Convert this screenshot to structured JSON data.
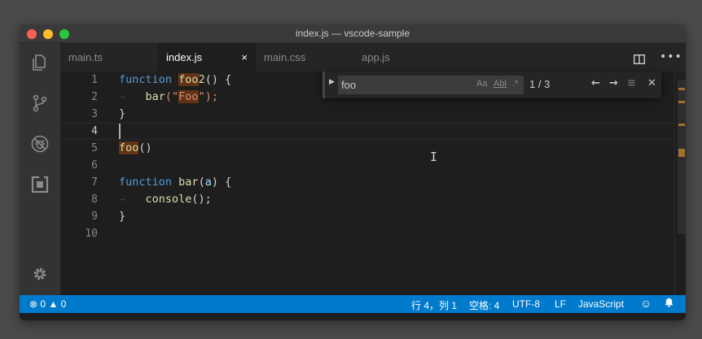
{
  "window": {
    "title": "index.js — vscode-sample"
  },
  "activity_bar": {
    "items": [
      {
        "name": "explorer-icon"
      },
      {
        "name": "source-control-icon"
      },
      {
        "name": "debug-icon"
      },
      {
        "name": "extensions-icon"
      },
      {
        "name": "settings-gear-icon"
      }
    ]
  },
  "tabs": [
    {
      "label": "main.ts",
      "active": false
    },
    {
      "label": "index.js",
      "active": true,
      "close": "×"
    },
    {
      "label": "main.css",
      "active": false
    },
    {
      "label": "app.js",
      "active": false
    }
  ],
  "tab_actions": {
    "more": "•••"
  },
  "editor": {
    "line_numbers": [
      "1",
      "2",
      "3",
      "4",
      "5",
      "6",
      "7",
      "8",
      "9",
      "10"
    ],
    "current_line": "4",
    "code": {
      "l1": {
        "kw": "function",
        "fn_match": "foo",
        "fn_rest": "2",
        "punc": "() {"
      },
      "l2": {
        "fn": "bar",
        "open": "(\"",
        "match": "Foo",
        "close": "\");"
      },
      "l3": "}",
      "l5": {
        "match": "foo",
        "punc": "()"
      },
      "l7": {
        "kw": "function",
        "fn": "bar",
        "open": "(",
        "param": "a",
        "close": ") {"
      },
      "l8": {
        "fn": "console",
        "punc": "();"
      },
      "l9": "}"
    }
  },
  "find": {
    "toggle": "▶",
    "query": "foo",
    "opt_case": "Aa",
    "opt_word": "Abl",
    "opt_regex": ".*",
    "count": "1 / 3",
    "prev": "←",
    "next": "→",
    "in_selection": "≡",
    "close": "✕"
  },
  "status_bar": {
    "errors": "0",
    "warnings": "0",
    "position": "行 4，列 1",
    "indent": "空格: 4",
    "encoding": "UTF-8",
    "eol": "LF",
    "language": "JavaScript"
  },
  "colors": {
    "status_bar": "#007acc",
    "keyword": "#569cd6",
    "function": "#dcdcaa",
    "string": "#ce9178",
    "match_highlight": "#613214"
  }
}
